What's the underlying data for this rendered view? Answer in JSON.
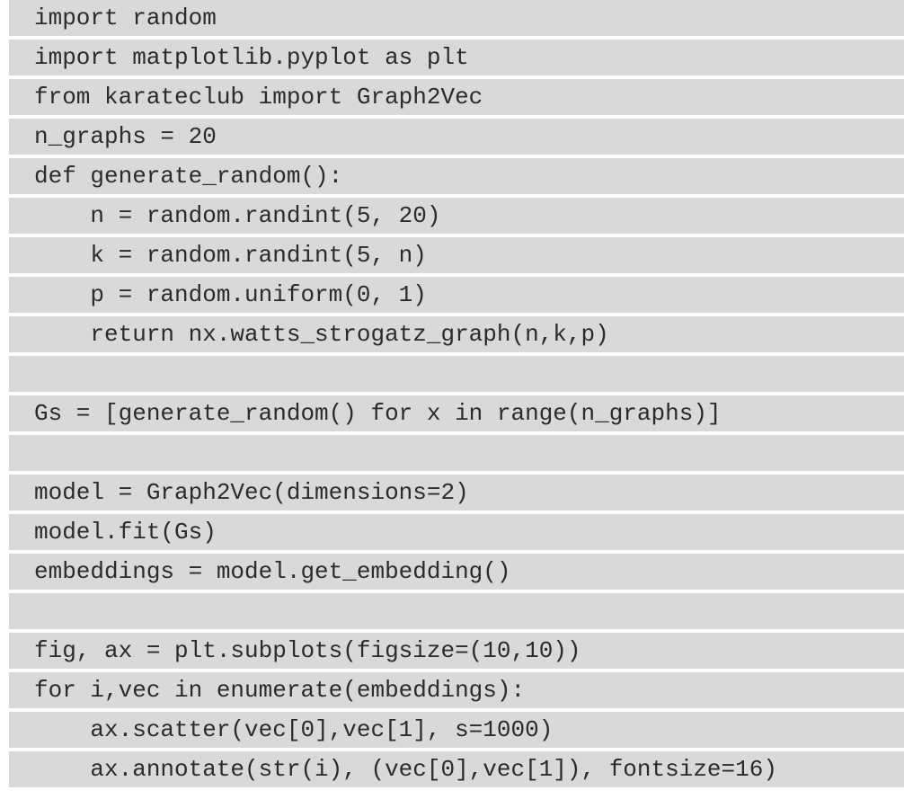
{
  "code": {
    "lines": [
      "import random",
      "import matplotlib.pyplot as plt",
      "from karateclub import Graph2Vec",
      "n_graphs = 20",
      "def generate_random():",
      "    n = random.randint(5, 20)",
      "    k = random.randint(5, n)",
      "    p = random.uniform(0, 1)",
      "    return nx.watts_strogatz_graph(n,k,p)",
      "",
      "Gs = [generate_random() for x in range(n_graphs)]",
      "",
      "model = Graph2Vec(dimensions=2)",
      "model.fit(Gs)",
      "embeddings = model.get_embedding()",
      "",
      "fig, ax = plt.subplots(figsize=(10,10))",
      "for i,vec in enumerate(embeddings):",
      "    ax.scatter(vec[0],vec[1], s=1000)",
      "    ax.annotate(str(i), (vec[0],vec[1]), fontsize=16)"
    ]
  }
}
